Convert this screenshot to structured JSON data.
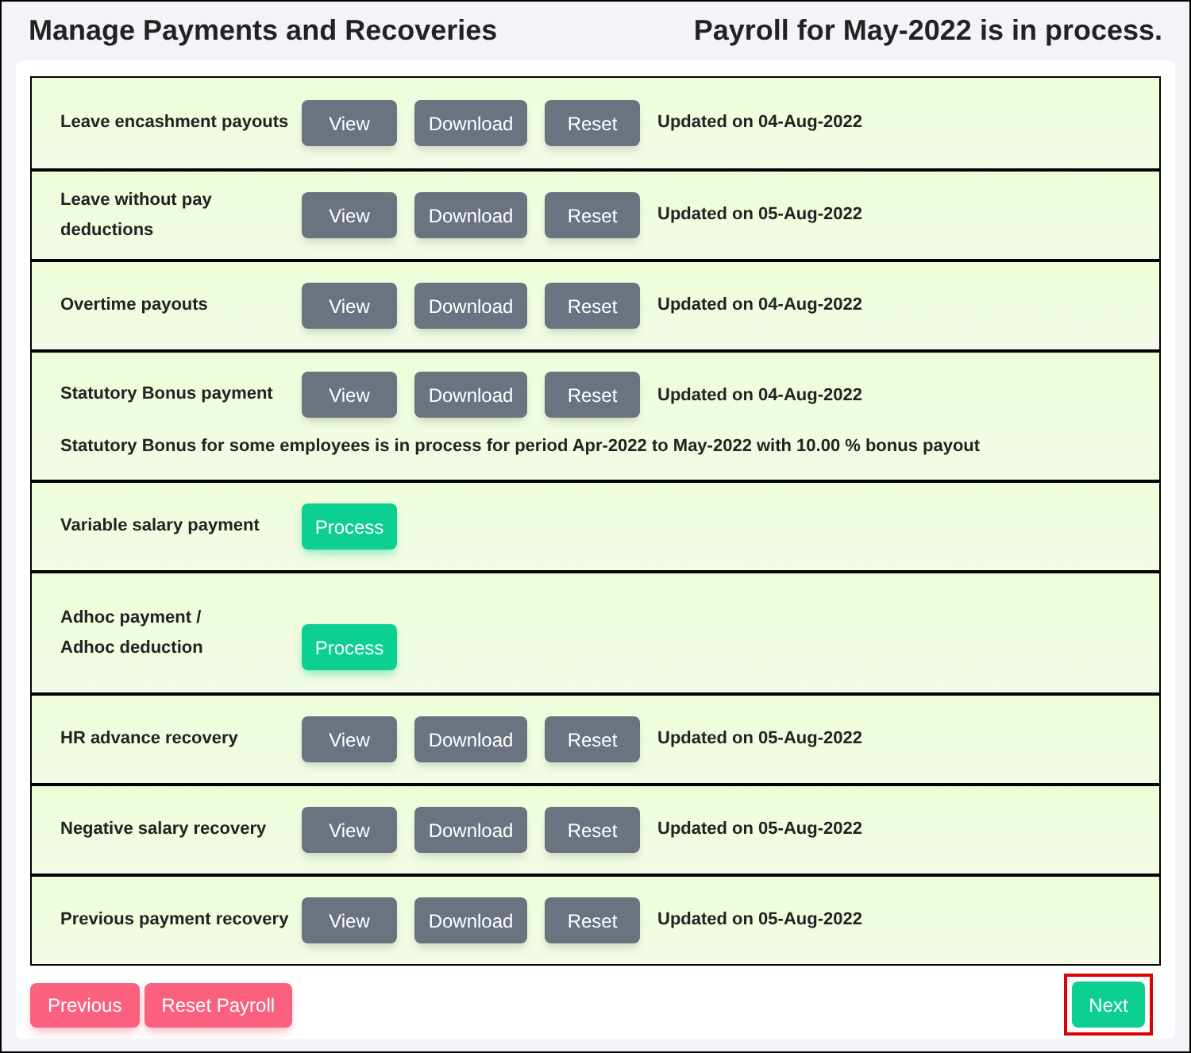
{
  "header": {
    "title": "Manage Payments and Recoveries",
    "status": "Payroll for May-2022 is in process."
  },
  "rows": [
    {
      "kind": "actions",
      "label": "Leave encashment payouts",
      "buttons": [
        "View",
        "Download",
        "Reset"
      ],
      "updated": "Updated on 04-Aug-2022"
    },
    {
      "kind": "actions",
      "label": "Leave without pay deductions",
      "buttons": [
        "View",
        "Download",
        "Reset"
      ],
      "updated": "Updated on 05-Aug-2022"
    },
    {
      "kind": "actions",
      "label": "Overtime payouts",
      "buttons": [
        "View",
        "Download",
        "Reset"
      ],
      "updated": "Updated on 04-Aug-2022"
    },
    {
      "kind": "actions",
      "label": "Statutory Bonus payment",
      "buttons": [
        "View",
        "Download",
        "Reset"
      ],
      "updated": "Updated on 04-Aug-2022",
      "note": "Statutory Bonus for some employees is in process for period Apr-2022 to May-2022 with 10.00 % bonus payout"
    },
    {
      "kind": "process",
      "label": "Variable salary payment",
      "buttons": [
        "Process"
      ]
    },
    {
      "kind": "process",
      "label": "Adhoc payment / Adhoc deduction",
      "buttons": [
        "Process"
      ]
    },
    {
      "kind": "actions",
      "label": "HR advance recovery",
      "buttons": [
        "View",
        "Download",
        "Reset"
      ],
      "updated": "Updated on 05-Aug-2022"
    },
    {
      "kind": "actions",
      "label": "Negative salary recovery",
      "buttons": [
        "View",
        "Download",
        "Reset"
      ],
      "updated": "Updated on 05-Aug-2022"
    },
    {
      "kind": "actions",
      "label": "Previous payment recovery",
      "buttons": [
        "View",
        "Download",
        "Reset"
      ],
      "updated": "Updated on 05-Aug-2022"
    }
  ],
  "footer": {
    "left_buttons": [
      "Previous",
      "Reset Payroll"
    ],
    "next": {
      "label": "Next",
      "highlighted": true
    }
  }
}
